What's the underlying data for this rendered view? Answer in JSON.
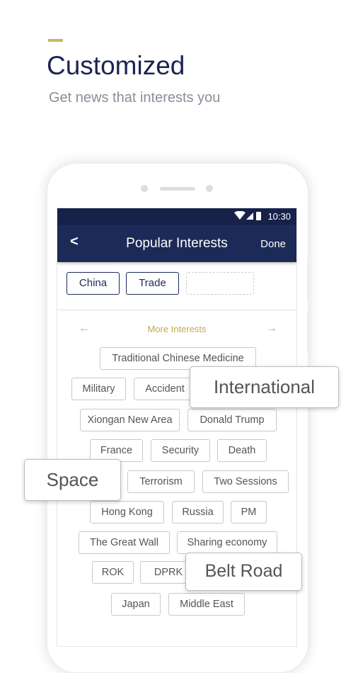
{
  "header": {
    "title": "Customized",
    "subtitle": "Get news that interests you"
  },
  "status_bar": {
    "time": "10:30"
  },
  "app_bar": {
    "back": "<",
    "title": "Popular Interests",
    "done": "Done"
  },
  "selected": [
    "China",
    "Trade"
  ],
  "more": {
    "label": "More Interests",
    "prev": "←",
    "next": "→"
  },
  "tags": [
    "Traditional Chinese Medicine",
    "Military",
    "Accident",
    "Xiongan New Area",
    "Donald Trump",
    "France",
    "Security",
    "Death",
    "",
    "Terrorism",
    "Two Sessions",
    "Hong Kong",
    "Russia",
    "PM",
    "The Great Wall",
    "Sharing economy",
    "ROK",
    "DPRK",
    "Japan",
    "Middle East"
  ],
  "floating": [
    "International",
    "Space",
    "Belt Road"
  ],
  "colors": {
    "navy": "#1c2a57",
    "gold": "#c4a84c"
  }
}
